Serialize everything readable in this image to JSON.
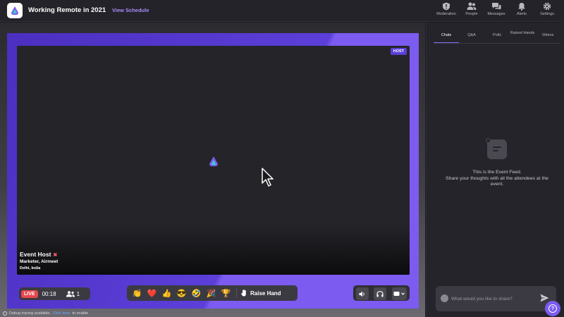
{
  "header": {
    "title": "Working Remote in 2021",
    "view_schedule": "View Schedule",
    "nav": [
      {
        "label": "Moderation",
        "icon": "shield-icon"
      },
      {
        "label": "People",
        "icon": "people-icon"
      },
      {
        "label": "Messages",
        "icon": "messages-icon"
      },
      {
        "label": "Alerts",
        "icon": "bell-icon"
      },
      {
        "label": "Settings",
        "icon": "gear-icon"
      }
    ]
  },
  "stage": {
    "host_badge": "HOST",
    "speaker": {
      "name": "Event Host",
      "role": "Marketer, Airmeet",
      "location": "Delhi, India"
    }
  },
  "controls": {
    "live_label": "LIVE",
    "timer": "00:18",
    "attendee_count": "1",
    "reactions": [
      "👏",
      "❤️",
      "👍",
      "😎",
      "🤣",
      "🎉",
      "🏆"
    ],
    "raise_hand": "Raise Hand"
  },
  "debug": {
    "text": "Debug tracing available,",
    "link": "Click here",
    "suffix": "to enable"
  },
  "side_panel": {
    "tabs": [
      "Chats",
      "Q&A",
      "Polls",
      "Raised Hands",
      "Videos"
    ],
    "active_tab": "Chats",
    "feed_line1": "This is the Event Feed.",
    "feed_line2": "Share your thoughts with all the attendees at the event.",
    "chat_placeholder": "What would you like to share?"
  },
  "colors": {
    "accent": "#7c5bf0",
    "live": "#e5484d",
    "link": "#a78bfa"
  }
}
